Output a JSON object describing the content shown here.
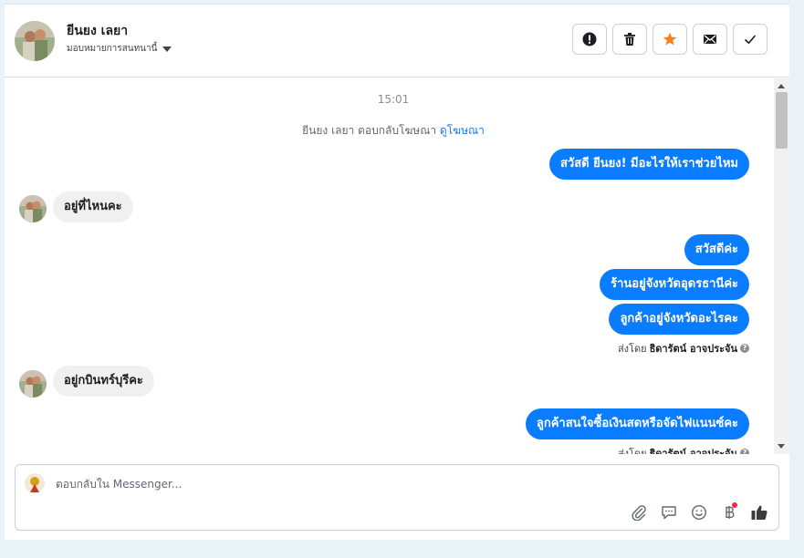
{
  "header": {
    "contact_name": "ยีนยง เลยา",
    "assign_label": "มอบหมายการสนทนานี้",
    "actions": [
      {
        "icon": "alert-icon",
        "color": "#1c1e21"
      },
      {
        "icon": "trash-icon",
        "color": "#1c1e21"
      },
      {
        "icon": "star-icon",
        "color": "#f5821f"
      },
      {
        "icon": "envelope-icon",
        "color": "#1c1e21"
      },
      {
        "icon": "check-icon",
        "color": "#1c1e21"
      }
    ]
  },
  "thread": {
    "time": "15:01",
    "ad_reply_text": "ยีนยง เลยา ตอบกลับโฆษณา",
    "ad_link": "ดูโฆษณา",
    "messages": [
      {
        "direction": "out",
        "text": "สวัสดี ยีนยง! มีอะไรให้เราช่วยไหม"
      },
      {
        "direction": "in",
        "text": "อยู่ที่ไหนคะ"
      },
      {
        "direction": "out",
        "text": "สวัสดีค่ะ"
      },
      {
        "direction": "out",
        "text": "ร้านอยู่จังหวัดอุดรธานีค่ะ"
      },
      {
        "direction": "out",
        "text": "ลูกค้าอยู่จังหวัดอะไรคะ"
      },
      {
        "direction": "in",
        "text": "อยู่กบินทร์บุรีคะ"
      },
      {
        "direction": "out",
        "text": "ลูกค้าสนใจซื้อเงินสดหรือจัดไฟแนนซ์คะ"
      }
    ],
    "sent_by_prefix": "ส่งโดย",
    "sent_by_name": "ธิดารัตน์ อาจประจัน",
    "help_glyph": "?"
  },
  "composer": {
    "placeholder": "ตอบกลับใน Messenger...",
    "value": "",
    "tools": [
      "paperclip-icon",
      "saved-reply-icon",
      "emoji-icon",
      "baht-icon",
      "thumbs-up-icon"
    ]
  },
  "colors": {
    "outgoing_bubble": "#0a7cff",
    "incoming_bubble": "#f0f0f0",
    "link": "#1877f2",
    "star": "#f5821f"
  }
}
